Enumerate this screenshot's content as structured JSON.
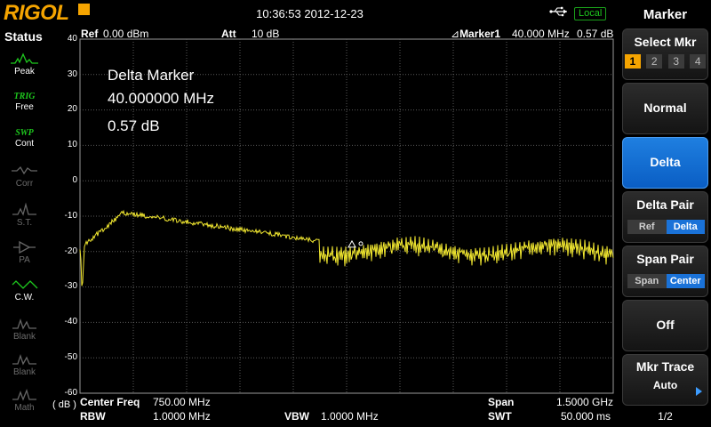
{
  "header": {
    "brand": "RIGOL",
    "datetime": "10:36:53 2012-12-23",
    "remote_status": "Local"
  },
  "status_panel": {
    "title": "Status",
    "items": [
      {
        "label": "Peak",
        "icon": "peak-icon",
        "active": true
      },
      {
        "word": "TRIG",
        "label": "Free",
        "active": true
      },
      {
        "word": "SWP",
        "label": "Cont",
        "active": true
      },
      {
        "label": "Corr",
        "icon": "corr-icon",
        "active": false
      },
      {
        "label": "S.T.",
        "icon": "st-icon",
        "active": false
      },
      {
        "label": "PA",
        "icon": "pa-icon",
        "active": false
      },
      {
        "label": "C.W.",
        "icon": "cw-icon",
        "active": true
      },
      {
        "label": "Blank",
        "icon": "blank-icon",
        "active": false
      },
      {
        "label": "Blank",
        "icon": "blank-icon",
        "active": false
      },
      {
        "label": "Math",
        "icon": "math-icon",
        "active": false
      }
    ]
  },
  "graph": {
    "ref_label": "Ref",
    "ref_value": "0.00 dBm",
    "att_label": "Att",
    "att_value": "10 dB",
    "marker_label": "Marker1",
    "marker_freq": "40.000 MHz",
    "marker_level": "0.57 dB",
    "delta_title": "Delta Marker",
    "delta_freq": "40.000000 MHz",
    "delta_level": "0.57 dB",
    "y_unit": "( dB )",
    "y_ticks": [
      "40",
      "30",
      "20",
      "10",
      "0",
      "-10",
      "-20",
      "-30",
      "-40",
      "-50",
      "-60"
    ],
    "center_freq_label": "Center Freq",
    "center_freq_value": "750.00 MHz",
    "rbw_label": "RBW",
    "rbw_value": "1.0000 MHz",
    "vbw_label": "VBW",
    "vbw_value": "1.0000 MHz",
    "span_label": "Span",
    "span_value": "1.5000 GHz",
    "swt_label": "SWT",
    "swt_value": "50.000 ms",
    "trace_color": "#f2e830"
  },
  "menu": {
    "title": "Marker",
    "select_mkr_label": "Select Mkr",
    "marker_numbers": [
      "1",
      "2",
      "3",
      "4"
    ],
    "selected_marker": "1",
    "normal_label": "Normal",
    "delta_label": "Delta",
    "delta_pair_label": "Delta Pair",
    "delta_pair_options": [
      "Ref",
      "Delta"
    ],
    "span_pair_label": "Span Pair",
    "span_pair_options": [
      "Span",
      "Center"
    ],
    "off_label": "Off",
    "mkr_trace_label": "Mkr Trace",
    "mkr_trace_value": "Auto",
    "page_indicator": "1/2",
    "accent_color": "#1a72d8"
  }
}
